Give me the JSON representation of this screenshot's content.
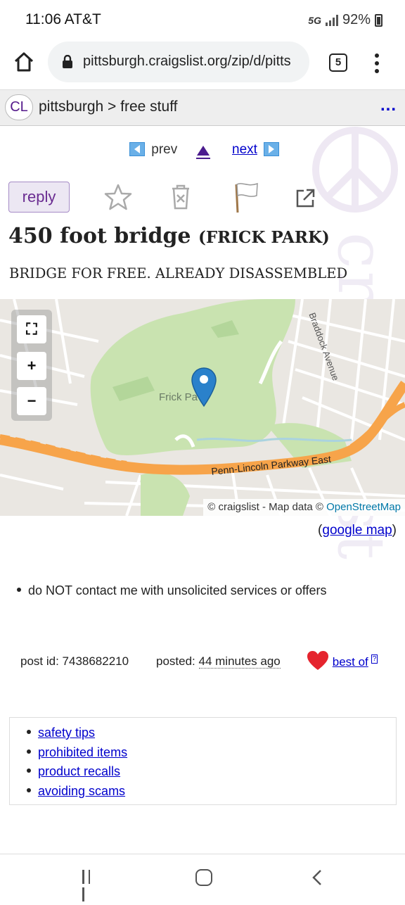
{
  "status_bar": {
    "time": "11:06 AT&T",
    "network": "5G",
    "battery": "92%"
  },
  "browser": {
    "url": "pittsburgh.craigslist.org/zip/d/pitts",
    "tab_count": "5"
  },
  "header": {
    "logo": "CL",
    "breadcrumb": "pittsburgh > free stuff",
    "more": "..."
  },
  "watermark": "craigslist",
  "nav": {
    "prev": "prev",
    "next": "next"
  },
  "actions": {
    "reply": "reply"
  },
  "post": {
    "title": "450 foot bridge",
    "location": "(FRICK PARK)",
    "description": "BRIDGE FOR FREE. ALREADY DISASSEMBLED"
  },
  "map": {
    "place_label": "Frick Pa",
    "road_label_1": "Penn-Lincoln Parkway East",
    "road_label_2": "Braddock Avenue",
    "attribution_prefix": "© craigslist - Map data ©",
    "attribution_osm": "OpenStreetMap",
    "google_map_link": "google map"
  },
  "notices": [
    "do NOT contact me with unsolicited services or offers"
  ],
  "post_info": {
    "post_id_label": "post id: 7438682210",
    "posted_label": "posted:",
    "posted_ago": "44 minutes ago",
    "best_of": "best of",
    "best_of_help": "?"
  },
  "footer_links": [
    "safety tips",
    "prohibited items",
    "product recalls",
    "avoiding scams"
  ],
  "colors": {
    "link": "#0000cc",
    "reply_bg": "#ece7f3",
    "map_park": "#c9e3b0",
    "highway": "#f7a44a"
  }
}
